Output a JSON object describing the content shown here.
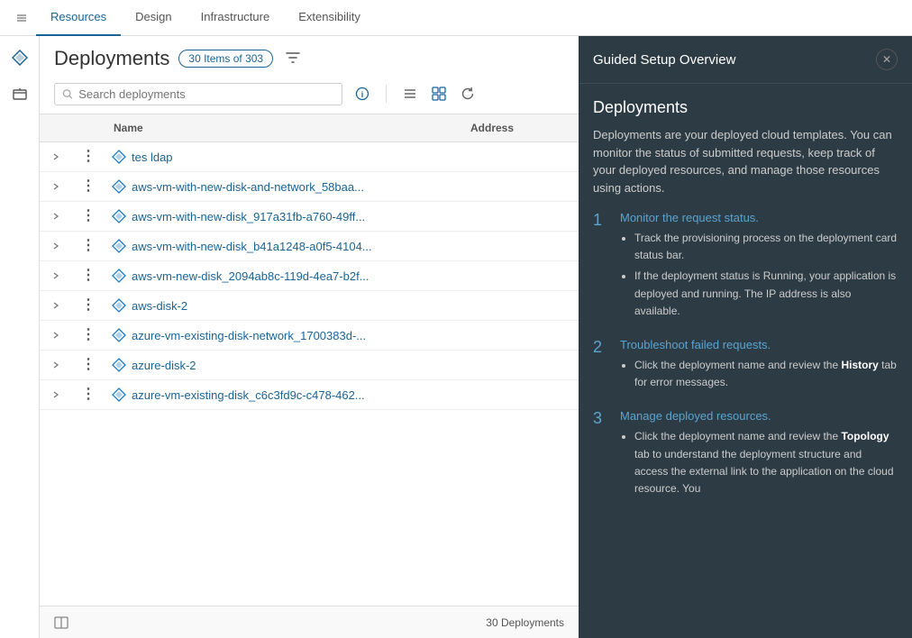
{
  "nav": {
    "tabs": [
      {
        "id": "resources",
        "label": "Resources",
        "active": true
      },
      {
        "id": "design",
        "label": "Design",
        "active": false
      },
      {
        "id": "infrastructure",
        "label": "Infrastructure",
        "active": false
      },
      {
        "id": "extensibility",
        "label": "Extensibility",
        "active": false
      }
    ],
    "collapse_label": "<<"
  },
  "sidebar": {
    "icons": [
      {
        "id": "nav-icon-1",
        "symbol": "◈"
      },
      {
        "id": "nav-icon-2",
        "symbol": "⬡"
      }
    ]
  },
  "header": {
    "title": "Deployments",
    "items_badge": "30 Items of 303",
    "filter_icon": "⊟"
  },
  "search": {
    "placeholder": "Search deployments"
  },
  "toolbar": {
    "info_icon": "ℹ",
    "list_icon": "☰",
    "grid_icon": "⊞",
    "refresh_icon": "↻"
  },
  "table": {
    "columns": [
      {
        "id": "expand",
        "label": ""
      },
      {
        "id": "menu",
        "label": ""
      },
      {
        "id": "name",
        "label": "Name"
      },
      {
        "id": "address",
        "label": "Address"
      }
    ],
    "rows": [
      {
        "id": 1,
        "name": "tes ldap",
        "address": ""
      },
      {
        "id": 2,
        "name": "aws-vm-with-new-disk-and-network_58baa...",
        "address": ""
      },
      {
        "id": 3,
        "name": "aws-vm-with-new-disk_917a31fb-a760-49ff...",
        "address": ""
      },
      {
        "id": 4,
        "name": "aws-vm-with-new-disk_b41a1248-a0f5-4104...",
        "address": ""
      },
      {
        "id": 5,
        "name": "aws-vm-new-disk_2094ab8c-119d-4ea7-b2f...",
        "address": ""
      },
      {
        "id": 6,
        "name": "aws-disk-2",
        "address": ""
      },
      {
        "id": 7,
        "name": "azure-vm-existing-disk-network_1700383d-...",
        "address": ""
      },
      {
        "id": 8,
        "name": "azure-disk-2",
        "address": ""
      },
      {
        "id": 9,
        "name": "azure-vm-existing-disk_c6c3fd9c-c478-462...",
        "address": ""
      }
    ],
    "footer": {
      "count_label": "30 Deployments",
      "split_icon": "⊟"
    }
  },
  "right_panel": {
    "title": "Guided Setup Overview",
    "close_icon": "✕",
    "section_title": "Deployments",
    "intro": "Deployments are your deployed cloud templates. You can monitor the status of submitted requests, keep track of your deployed resources, and manage those resources using actions.",
    "steps": [
      {
        "num": "1",
        "heading": "Monitor the request status.",
        "bullets": [
          "Track the provisioning process on the deployment card status bar.",
          "If the deployment status is Running, your application is deployed and running. The IP address is also available."
        ]
      },
      {
        "num": "2",
        "heading": "Troubleshoot failed requests.",
        "bullets": [
          "Click the deployment name and review the <strong>History</strong> tab for error messages."
        ]
      },
      {
        "num": "3",
        "heading": "Manage deployed resources.",
        "bullets": [
          "Click the deployment name and review the <strong>Topology</strong> tab to understand the deployment structure and access the external link to the application on the cloud resource. You"
        ]
      }
    ]
  }
}
